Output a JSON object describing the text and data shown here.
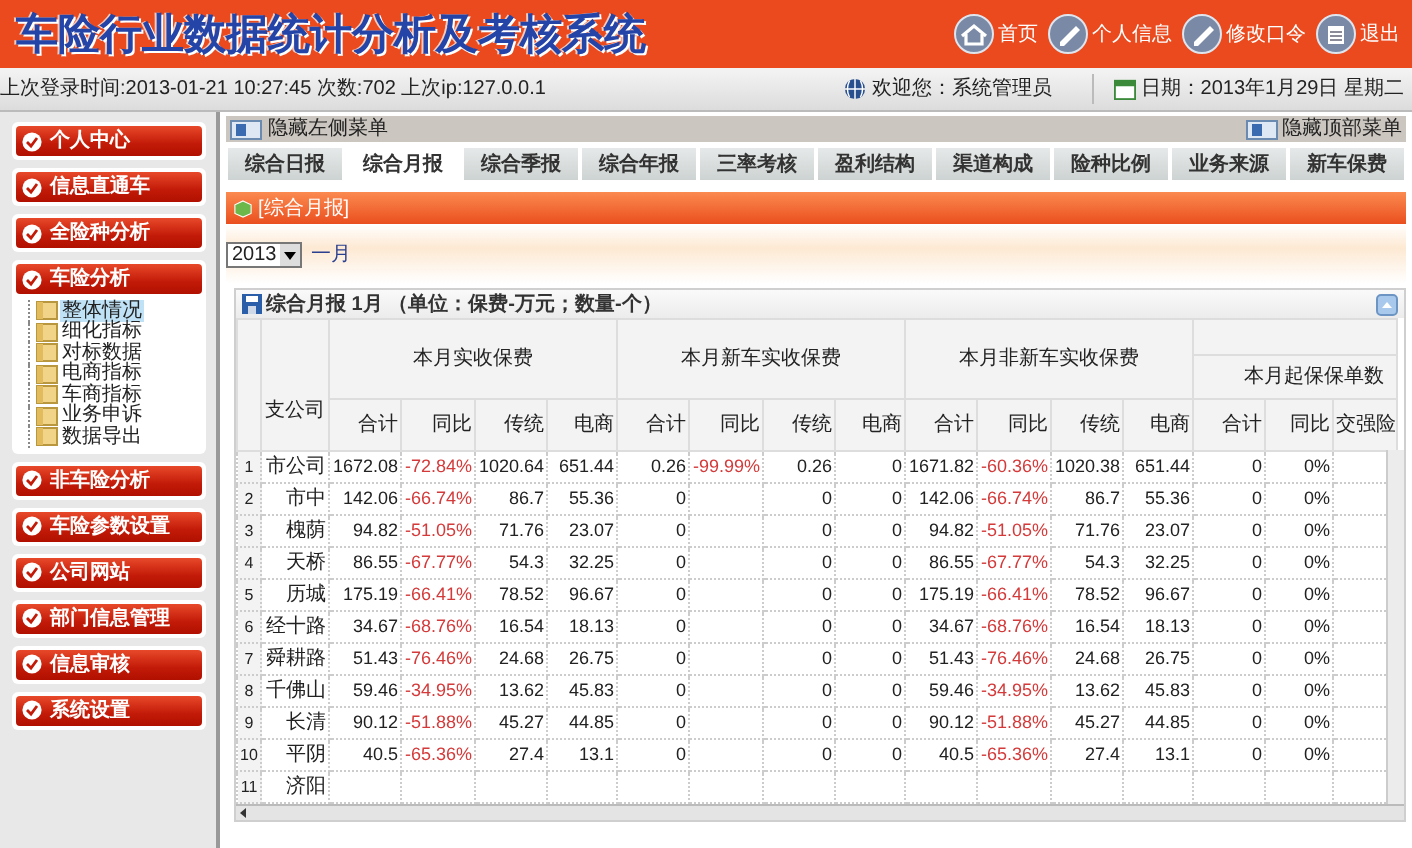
{
  "header": {
    "title": "车险行业数据统计分析及考核系统",
    "nav": [
      {
        "label": "首页",
        "kind": "home"
      },
      {
        "label": "个人信息",
        "kind": "pencil"
      },
      {
        "label": "修改口令",
        "kind": "pencil"
      },
      {
        "label": "退出",
        "kind": "calculator"
      }
    ]
  },
  "info_bar": {
    "last_login": "上次登录时间:2013-01-21 10:27:45 次数:702 上次ip:127.0.0.1",
    "welcome": "欢迎您：系统管理员",
    "date": "日期：2013年1月29日  星期二"
  },
  "sidebar": [
    {
      "label": "个人中心"
    },
    {
      "label": "信息直通车"
    },
    {
      "label": "全险种分析"
    },
    {
      "label": "车险分析",
      "children": [
        {
          "label": "整体情况",
          "selected": true
        },
        {
          "label": "细化指标",
          "selected": false
        },
        {
          "label": "对标数据",
          "selected": false
        },
        {
          "label": "电商指标",
          "selected": false
        },
        {
          "label": "车商指标",
          "selected": false
        },
        {
          "label": "业务申诉",
          "selected": false
        },
        {
          "label": "数据导出",
          "selected": false
        }
      ]
    },
    {
      "label": "非车险分析"
    },
    {
      "label": "车险参数设置"
    },
    {
      "label": "公司网站"
    },
    {
      "label": "部门信息管理"
    },
    {
      "label": "信息审核"
    },
    {
      "label": "系统设置"
    }
  ],
  "toolbar": {
    "hide_left": "隐藏左侧菜单",
    "hide_top": "隐藏顶部菜单"
  },
  "tabs": [
    {
      "label": "综合日报",
      "selected": false
    },
    {
      "label": "综合月报",
      "selected": true
    },
    {
      "label": "综合季报",
      "selected": false
    },
    {
      "label": "综合年报",
      "selected": false
    },
    {
      "label": "三率考核",
      "selected": false
    },
    {
      "label": "盈利结构",
      "selected": false
    },
    {
      "label": "渠道构成",
      "selected": false
    },
    {
      "label": "险种比例",
      "selected": false
    },
    {
      "label": "业务来源",
      "selected": false
    },
    {
      "label": "新车保费",
      "selected": false
    }
  ],
  "panel": {
    "title": "[综合月报]",
    "year": "2013",
    "month": "一月"
  },
  "table": {
    "caption": "综合月报  1月 （单位：保费-万元；数量-个）",
    "branch_header": "支公司",
    "groups": [
      {
        "label": "本月实收保费",
        "kind": "single",
        "columns": [
          "合计",
          "同比",
          "传统",
          "电商"
        ]
      },
      {
        "label": "本月新车实收保费",
        "kind": "single",
        "columns": [
          "合计",
          "同比",
          "传统",
          "电商"
        ]
      },
      {
        "label": "本月非新车实收保费",
        "kind": "single",
        "columns": [
          "合计",
          "同比",
          "传统",
          "电商"
        ]
      },
      {
        "label": "本月起保保单数",
        "kind": "split",
        "columns": [
          "合计",
          "同比",
          "交强险"
        ]
      }
    ],
    "rows": [
      {
        "num": "1",
        "name": "市公司",
        "cells": [
          "1672.08",
          "-72.84%",
          "1020.64",
          "651.44",
          "0.26",
          "-99.99%",
          "0.26",
          "0",
          "1671.82",
          "-60.36%",
          "1020.38",
          "651.44",
          "0",
          "0%"
        ]
      },
      {
        "num": "2",
        "name": "市中",
        "cells": [
          "142.06",
          "-66.74%",
          "86.7",
          "55.36",
          "0",
          null,
          "0",
          "0",
          "142.06",
          "-66.74%",
          "86.7",
          "55.36",
          "0",
          "0%"
        ]
      },
      {
        "num": "3",
        "name": "槐荫",
        "cells": [
          "94.82",
          "-51.05%",
          "71.76",
          "23.07",
          "0",
          null,
          "0",
          "0",
          "94.82",
          "-51.05%",
          "71.76",
          "23.07",
          "0",
          "0%"
        ]
      },
      {
        "num": "4",
        "name": "天桥",
        "cells": [
          "86.55",
          "-67.77%",
          "54.3",
          "32.25",
          "0",
          null,
          "0",
          "0",
          "86.55",
          "-67.77%",
          "54.3",
          "32.25",
          "0",
          "0%"
        ]
      },
      {
        "num": "5",
        "name": "历城",
        "cells": [
          "175.19",
          "-66.41%",
          "78.52",
          "96.67",
          "0",
          null,
          "0",
          "0",
          "175.19",
          "-66.41%",
          "78.52",
          "96.67",
          "0",
          "0%"
        ]
      },
      {
        "num": "6",
        "name": "经十路",
        "cells": [
          "34.67",
          "-68.76%",
          "16.54",
          "18.13",
          "0",
          null,
          "0",
          "0",
          "34.67",
          "-68.76%",
          "16.54",
          "18.13",
          "0",
          "0%"
        ]
      },
      {
        "num": "7",
        "name": "舜耕路",
        "cells": [
          "51.43",
          "-76.46%",
          "24.68",
          "26.75",
          "0",
          null,
          "0",
          "0",
          "51.43",
          "-76.46%",
          "24.68",
          "26.75",
          "0",
          "0%"
        ]
      },
      {
        "num": "8",
        "name": "千佛山",
        "cells": [
          "59.46",
          "-34.95%",
          "13.62",
          "45.83",
          "0",
          null,
          "0",
          "0",
          "59.46",
          "-34.95%",
          "13.62",
          "45.83",
          "0",
          "0%"
        ]
      },
      {
        "num": "9",
        "name": "长清",
        "cells": [
          "90.12",
          "-51.88%",
          "45.27",
          "44.85",
          "0",
          null,
          "0",
          "0",
          "90.12",
          "-51.88%",
          "45.27",
          "44.85",
          "0",
          "0%"
        ]
      },
      {
        "num": "10",
        "name": "平阴",
        "cells": [
          "40.5",
          "-65.36%",
          "27.4",
          "13.1",
          "0",
          null,
          "0",
          "0",
          "40.5",
          "-65.36%",
          "27.4",
          "13.1",
          "0",
          "0%"
        ]
      },
      {
        "num": "11",
        "name": "济阳",
        "cells": []
      }
    ]
  }
}
